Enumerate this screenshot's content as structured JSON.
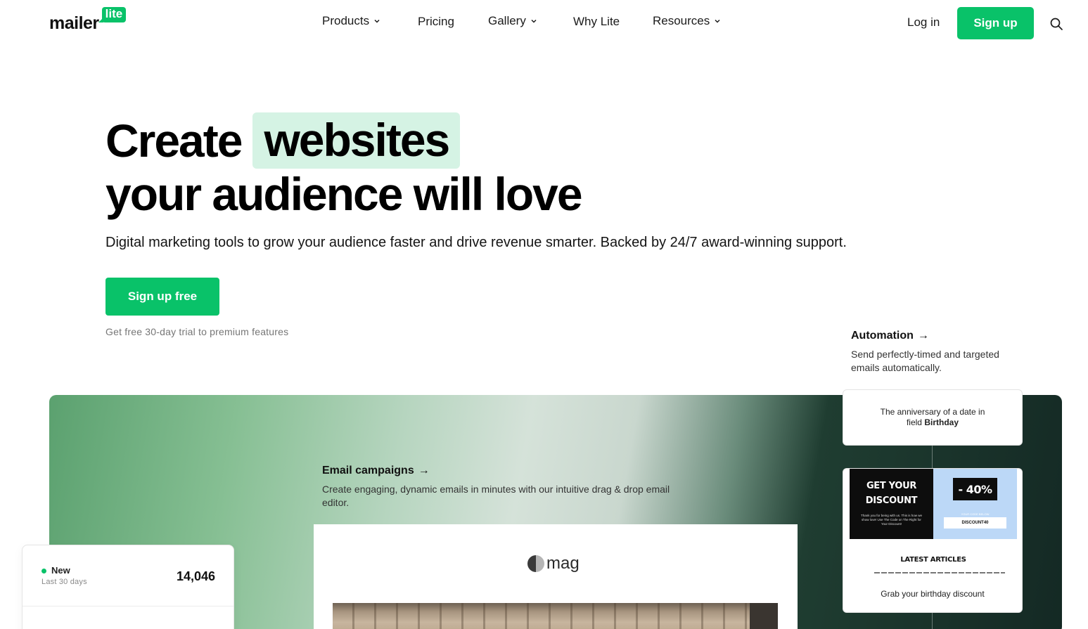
{
  "brand": {
    "logo_word": "mailer",
    "logo_badge": "lite",
    "accent": "#09c269"
  },
  "nav": {
    "items": [
      {
        "label": "Products",
        "has_dropdown": true
      },
      {
        "label": "Pricing",
        "has_dropdown": false
      },
      {
        "label": "Gallery",
        "has_dropdown": true
      },
      {
        "label": "Why Lite",
        "has_dropdown": false
      },
      {
        "label": "Resources",
        "has_dropdown": true
      }
    ],
    "login": "Log in",
    "signup": "Sign up"
  },
  "hero": {
    "title_part1": "Create",
    "title_highlight": "websites",
    "title_line2": "your audience will love",
    "subtitle": "Digital marketing tools to grow your audience faster and drive revenue smarter. Backed by 24/7 award-winning support.",
    "cta": "Sign up free",
    "trial_note": "Get free 30-day trial to premium features"
  },
  "features": {
    "email": {
      "title": "Email campaigns",
      "arrow": "→",
      "description": "Create engaging, dynamic emails in minutes with our intuitive drag & drop email editor."
    },
    "automation": {
      "title": "Automation",
      "arrow": "→",
      "description": "Send perfectly-timed and targeted emails automatically."
    }
  },
  "email_mockup": {
    "logo_text": "mag"
  },
  "stats": {
    "label": "New",
    "sub": "Last 30 days",
    "value": "14,046"
  },
  "automation_flow": {
    "trigger_line1": "The anniversary of a date in",
    "trigger_line2_prefix": "field ",
    "trigger_field": "Birthday",
    "preview": {
      "headline_1": "GET YOUR",
      "headline_2": "DISCOUNT",
      "body": "Thank you for being with us. This is how we show love! Use The Code on The Right for Your Discount!",
      "discount": "- 40%",
      "code_label": "YOUR CODE BELOW",
      "code": "DISCOUNT40",
      "articles": "LATEST ARTICLES"
    },
    "caption": "Grab your birthday discount"
  }
}
